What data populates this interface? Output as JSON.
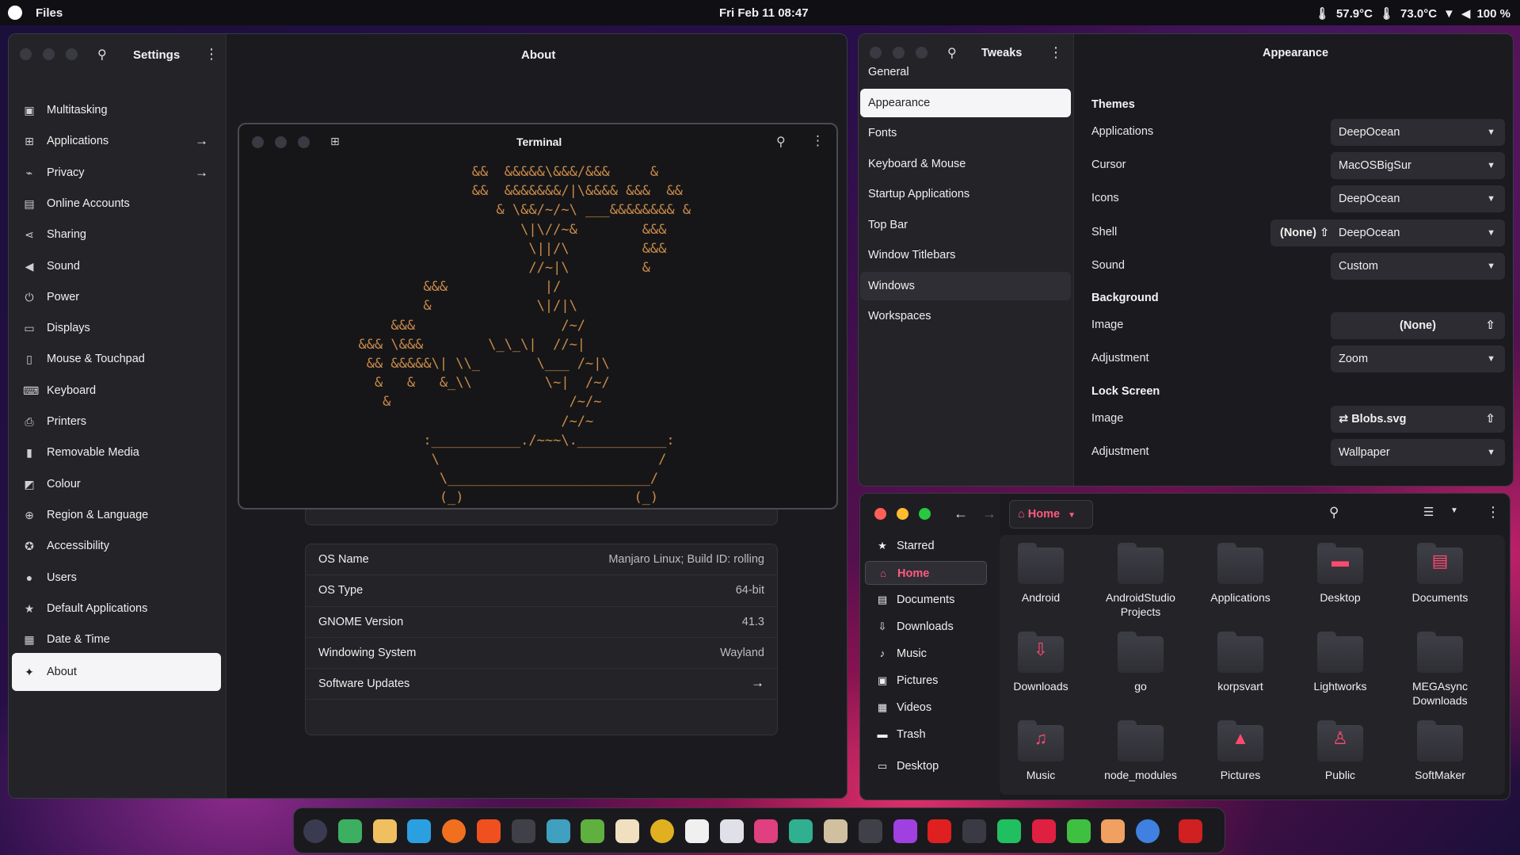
{
  "topbar": {
    "app": "Files",
    "clock": "Fri Feb 11  08:47",
    "temp1": "57.9°C",
    "temp2": "73.0°C",
    "battery": "100 %"
  },
  "settings": {
    "title": "Settings",
    "page_title": "About",
    "sidebar": [
      {
        "label": "Multitasking",
        "icon": "multitasking-icon",
        "glyph": "▣"
      },
      {
        "label": "Applications",
        "icon": "applications-icon",
        "glyph": "⊞",
        "arrow": true
      },
      {
        "label": "Privacy",
        "icon": "privacy-icon",
        "glyph": "⌁",
        "arrow": true
      },
      {
        "label": "Online Accounts",
        "icon": "online-accounts-icon",
        "glyph": "▤"
      },
      {
        "label": "Sharing",
        "icon": "sharing-icon",
        "glyph": "⋖"
      },
      {
        "label": "Sound",
        "icon": "sound-icon",
        "glyph": "◀"
      },
      {
        "label": "Power",
        "icon": "power-icon",
        "glyph": "⏻"
      },
      {
        "label": "Displays",
        "icon": "displays-icon",
        "glyph": "▭"
      },
      {
        "label": "Mouse & Touchpad",
        "icon": "mouse-icon",
        "glyph": "▯"
      },
      {
        "label": "Keyboard",
        "icon": "keyboard-icon",
        "glyph": "⌨"
      },
      {
        "label": "Printers",
        "icon": "printer-icon",
        "glyph": "⎙"
      },
      {
        "label": "Removable Media",
        "icon": "removable-media-icon",
        "glyph": "▮"
      },
      {
        "label": "Colour",
        "icon": "colour-icon",
        "glyph": "◩"
      },
      {
        "label": "Region & Language",
        "icon": "region-icon",
        "glyph": "⊕"
      },
      {
        "label": "Accessibility",
        "icon": "accessibility-icon",
        "glyph": "✪"
      },
      {
        "label": "Users",
        "icon": "users-icon",
        "glyph": "●"
      },
      {
        "label": "Default Applications",
        "icon": "star-icon",
        "glyph": "★"
      },
      {
        "label": "Date & Time",
        "icon": "date-time-icon",
        "glyph": "▦"
      },
      {
        "label": "About",
        "icon": "about-icon",
        "glyph": "✦",
        "active": true
      }
    ],
    "about_rows": [
      {
        "key": "OS Name",
        "value": "Manjaro Linux; Build ID: rolling"
      },
      {
        "key": "OS Type",
        "value": "64-bit"
      },
      {
        "key": "GNOME Version",
        "value": "41.3"
      },
      {
        "key": "Windowing System",
        "value": "Wayland"
      },
      {
        "key": "Software Updates",
        "value": "→"
      }
    ]
  },
  "terminal": {
    "title": "Terminal",
    "ascii": [
      "                &&  &&&&&\\&&&/&&&     &",
      "                &&  &&&&&&&/|\\&&&& &&&  &&",
      "                   & \\&&/~/~\\ ___&&&&&&&& &",
      "                      \\|\\//~&        &&&",
      "                       \\||/\\         &&&",
      "                       //~|\\         &",
      "          &&&            |/",
      "          &             \\|/|\\",
      "      &&&                  /~/",
      "  &&& \\&&&        \\_\\_\\|  //~|",
      "   && &&&&&\\| \\\\_       \\___ /~|\\",
      "    &   &   &_\\\\         \\~|  /~/",
      "     &                      /~/~",
      "                           /~/~",
      "          :___________./~~~\\.___________:",
      "           \\                           /",
      "            \\_________________________/",
      "            (_)                     (_)"
    ]
  },
  "tweaks": {
    "title": "Tweaks",
    "page_title": "Appearance",
    "sidebar": [
      "General",
      "Appearance",
      "Fonts",
      "Keyboard & Mouse",
      "Startup Applications",
      "Top Bar",
      "Window Titlebars",
      "Windows",
      "Workspaces"
    ],
    "themes_heading": "Themes",
    "themes": [
      {
        "label": "Applications",
        "value": "DeepOcean"
      },
      {
        "label": "Cursor",
        "value": "MacOSBigSur"
      },
      {
        "label": "Icons",
        "value": "DeepOcean"
      },
      {
        "label": "Shell",
        "value": "DeepOcean",
        "extra": "(None)"
      },
      {
        "label": "Sound",
        "value": "Custom"
      }
    ],
    "background_heading": "Background",
    "background": [
      {
        "label": "Image",
        "value": "(None)"
      },
      {
        "label": "Adjustment",
        "value": "Zoom"
      }
    ],
    "lock_heading": "Lock Screen",
    "lock": [
      {
        "label": "Image",
        "value": "Blobs.svg"
      },
      {
        "label": "Adjustment",
        "value": "Wallpaper"
      }
    ]
  },
  "files": {
    "location": "Home",
    "sidebar": [
      {
        "label": "Starred",
        "glyph": "★"
      },
      {
        "label": "Home",
        "glyph": "⌂",
        "active": true
      },
      {
        "label": "Documents",
        "glyph": "▤"
      },
      {
        "label": "Downloads",
        "glyph": "⇩"
      },
      {
        "label": "Music",
        "glyph": "♪"
      },
      {
        "label": "Pictures",
        "glyph": "▣"
      },
      {
        "label": "Videos",
        "glyph": "▦"
      },
      {
        "label": "Trash",
        "glyph": "▬"
      },
      {
        "label": "Desktop",
        "glyph": "▭"
      }
    ],
    "folders": [
      {
        "name": "Android",
        "sym": ""
      },
      {
        "name": "AndroidStudio Projects",
        "sym": ""
      },
      {
        "name": "Applications",
        "sym": ""
      },
      {
        "name": "Desktop",
        "sym": "▬"
      },
      {
        "name": "Documents",
        "sym": "▤"
      },
      {
        "name": "Downloads",
        "sym": "⇩"
      },
      {
        "name": "go",
        "sym": ""
      },
      {
        "name": "korpsvart",
        "sym": ""
      },
      {
        "name": "Lightworks",
        "sym": ""
      },
      {
        "name": "MEGAsync Downloads",
        "sym": ""
      },
      {
        "name": "Music",
        "sym": "♫"
      },
      {
        "name": "node_modules",
        "sym": ""
      },
      {
        "name": "Pictures",
        "sym": "▲"
      },
      {
        "name": "Public",
        "sym": "♙"
      },
      {
        "name": "SoftMaker",
        "sym": ""
      }
    ]
  },
  "dock": [
    {
      "name": "app-menu-icon",
      "color": "#3a3a50"
    },
    {
      "name": "calculator-icon",
      "color": "#3cb060"
    },
    {
      "name": "files-icon",
      "color": "#f0c060"
    },
    {
      "name": "telegram-icon",
      "color": "#2aa0e0"
    },
    {
      "name": "firefox-icon",
      "color": "#f07020"
    },
    {
      "name": "brave-icon",
      "color": "#f05020"
    },
    {
      "name": "terminal-icon",
      "color": "#404048"
    },
    {
      "name": "text-editor-icon",
      "color": "#40a0c0"
    },
    {
      "name": "android-studio-icon",
      "color": "#60b040"
    },
    {
      "name": "notes-icon",
      "color": "#f0e0c0"
    },
    {
      "name": "chrome-icon",
      "color": "#e0b020"
    },
    {
      "name": "mail-icon",
      "color": "#f0f0f0"
    },
    {
      "name": "news-icon",
      "color": "#e0e0e8"
    },
    {
      "name": "instagram-icon",
      "color": "#e04080"
    },
    {
      "name": "shotwell-icon",
      "color": "#30b090"
    },
    {
      "name": "gimp-icon",
      "color": "#d0c0a0"
    },
    {
      "name": "github-icon",
      "color": "#404048"
    },
    {
      "name": "figma-icon",
      "color": "#a040e0"
    },
    {
      "name": "monster-icon",
      "color": "#e02020"
    },
    {
      "name": "screenshot-icon",
      "color": "#3a3a44"
    },
    {
      "name": "spotify-icon",
      "color": "#20c060"
    },
    {
      "name": "audio-icon",
      "color": "#e02040"
    },
    {
      "name": "puzzle-icon",
      "color": "#40c040"
    },
    {
      "name": "office-icon",
      "color": "#f0a060"
    },
    {
      "name": "settings-icon",
      "color": "#4080e0"
    },
    {
      "name": "trash-icon",
      "color": "#d02020"
    }
  ]
}
